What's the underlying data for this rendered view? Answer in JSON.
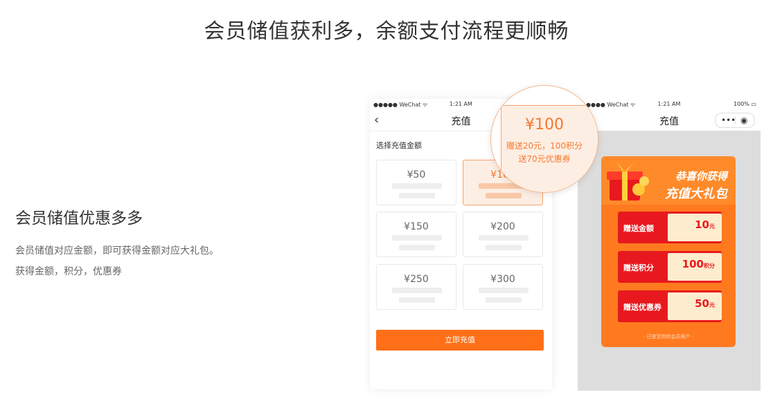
{
  "main_title": "会员储值获利多，余额支付流程更顺畅",
  "feature": {
    "title": "会员储值优惠多多",
    "desc_line1": "会员储值对应金额，即可获得金额对应大礼包。",
    "desc_line2": "获得金额，积分，优惠券"
  },
  "phone1": {
    "status": {
      "carrier": "●●●●● WeChat ᯤ",
      "time": "1:21 AM"
    },
    "nav": {
      "back": "‹",
      "title": "充值"
    },
    "select_label": "选择充值金额",
    "amounts": [
      "¥50",
      "¥100",
      "¥150",
      "¥200",
      "¥250",
      "¥300"
    ],
    "selected_index": 1,
    "button": "立即充值"
  },
  "magnifier": {
    "price": "¥100",
    "line1": "赠送20元，100积分",
    "line2": "送70元优惠券"
  },
  "phone2": {
    "status": {
      "carrier": "●●●●● WeChat ᯤ",
      "time": "1:21 AM",
      "battery": "100% ▭"
    },
    "nav": {
      "title": "充值"
    },
    "capsule": {
      "more": "•••",
      "record": "◉"
    },
    "gift": {
      "title1": "恭喜你获得",
      "title2": "充值大礼包",
      "rows": [
        {
          "label": "赠送金额",
          "value": "10",
          "unit": "元"
        },
        {
          "label": "赠送积分",
          "value": "100",
          "unit": "积分"
        },
        {
          "label": "赠送优惠券",
          "value": "50",
          "unit": "元"
        }
      ],
      "footer": "· 已放至你的会员账户 ·"
    }
  },
  "colors": {
    "accent": "#ff6f17",
    "red": "#e8191e",
    "cream": "#fdeccd"
  }
}
